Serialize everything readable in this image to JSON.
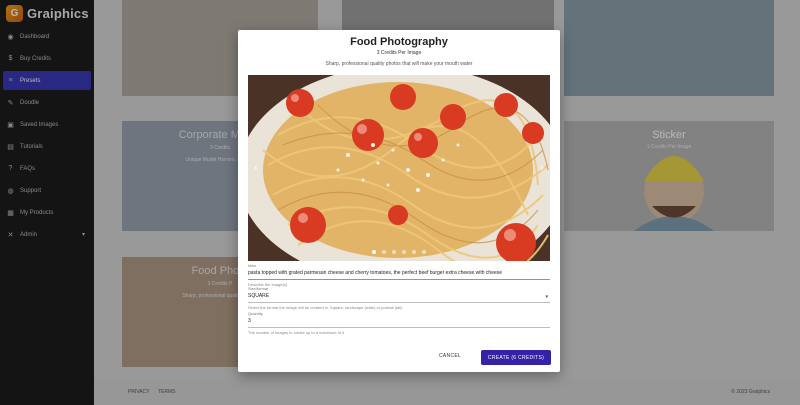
{
  "app": {
    "name": "Graiphics"
  },
  "sidebar": {
    "items": [
      {
        "label": "Dashboard",
        "icon": "dashboard-icon",
        "glyph": "◉",
        "active": false
      },
      {
        "label": "Buy Credits",
        "icon": "credits-icon",
        "glyph": "$",
        "active": false
      },
      {
        "label": "Presets",
        "icon": "presets-icon",
        "glyph": "≡",
        "active": true
      },
      {
        "label": "Doodle",
        "icon": "brush-icon",
        "glyph": "✎",
        "active": false
      },
      {
        "label": "Saved Images",
        "icon": "saved-images-icon",
        "glyph": "▣",
        "active": false
      },
      {
        "label": "Tutorials",
        "icon": "tutorials-icon",
        "glyph": "▤",
        "active": false
      },
      {
        "label": "FAQs",
        "icon": "faq-icon",
        "glyph": "?",
        "active": false
      },
      {
        "label": "Support",
        "icon": "support-icon",
        "glyph": "◍",
        "active": false
      },
      {
        "label": "My Products",
        "icon": "products-icon",
        "glyph": "▦",
        "active": false
      },
      {
        "label": "Admin",
        "icon": "admin-icon",
        "glyph": "✕",
        "active": false
      }
    ]
  },
  "background_cards": {
    "corporate": {
      "title": "Corporate Memp",
      "credits": "3 Credits",
      "desc": "Unique Model Horrors, Coming"
    },
    "sticker": {
      "title": "Sticker",
      "credits": "1 Credits Per Image"
    },
    "food": {
      "title": "Food Photo",
      "credits": "3 Credits P",
      "desc": "Sharp, professional quality photos"
    }
  },
  "modal": {
    "title": "Food Photography",
    "subtitle": "3 Credits Per Image",
    "description": "Sharp, professional quality photos that will make your mouth water",
    "prompt_label": "Idea",
    "prompt_value": "pasta topped with grated parmesan cheese and cherry tomatoes, the perfect beef burger extra cheese with cheese",
    "prompt_help": "Describe the image(s)",
    "format_label": "Size/format",
    "format_value": "SQUARE",
    "format_help": "Select the format the image will be created in. Square, landscape (wide) or portrait (tall)",
    "quantity_label": "Quantity",
    "quantity_value": "3",
    "quantity_help": "The number of images to create up to a maximum of 4",
    "cancel_label": "CANCEL",
    "create_label": "CREATE (6 CREDITS)"
  },
  "footer": {
    "privacy": "PRIVACY",
    "terms": "TERMS",
    "copyright": "© 2023 Graiphics"
  },
  "colors": {
    "accent": "#3423a6",
    "sidebar_bg": "#1d1d1d",
    "active_nav": "#3a39b8"
  }
}
